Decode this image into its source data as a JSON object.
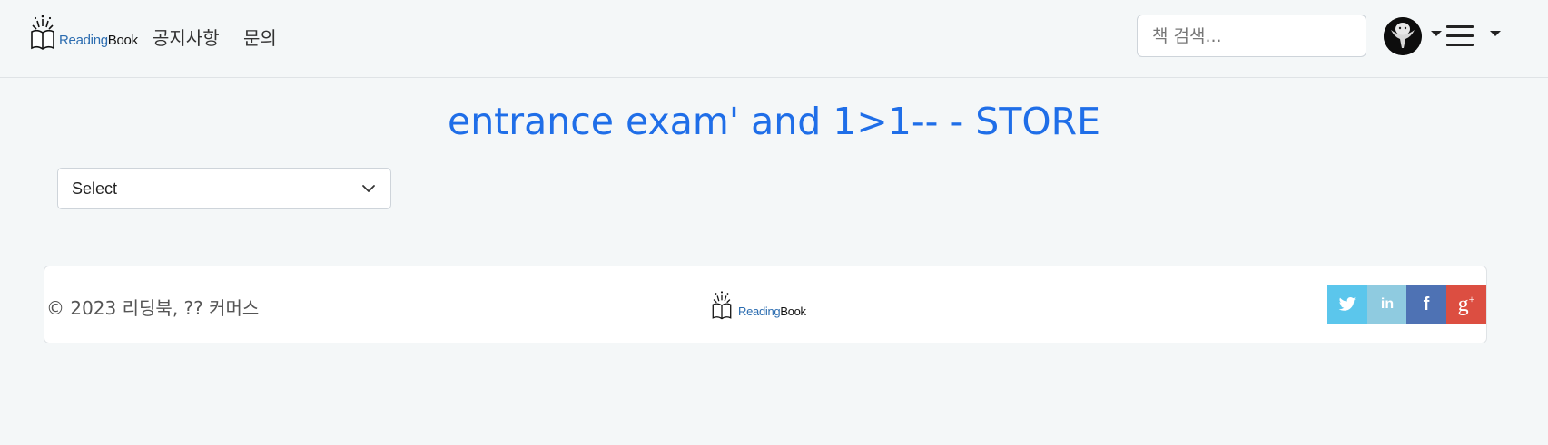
{
  "header": {
    "logo": {
      "part1": "Reading",
      "part2": "Book"
    },
    "nav": [
      {
        "label": "공지사항"
      },
      {
        "label": "문의"
      }
    ],
    "search": {
      "placeholder": "책 검색..."
    }
  },
  "main": {
    "title": "entrance exam' and 1>1-- - STORE",
    "select": {
      "selected": "Select"
    }
  },
  "footer": {
    "copyright": "© 2023 리딩북, ?? 커머스",
    "logo": {
      "part1": "Reading",
      "part2": "Book"
    },
    "social": [
      {
        "icon": "twitter-icon",
        "color": "#5bc6ec"
      },
      {
        "icon": "linkedin-icon",
        "color": "#8fcbe0"
      },
      {
        "icon": "facebook-icon",
        "color": "#4e72b4"
      },
      {
        "icon": "google-plus-icon",
        "color": "#dc4e41"
      }
    ]
  },
  "colors": {
    "accent": "#1f6ee8",
    "background": "#f4f7f8"
  }
}
